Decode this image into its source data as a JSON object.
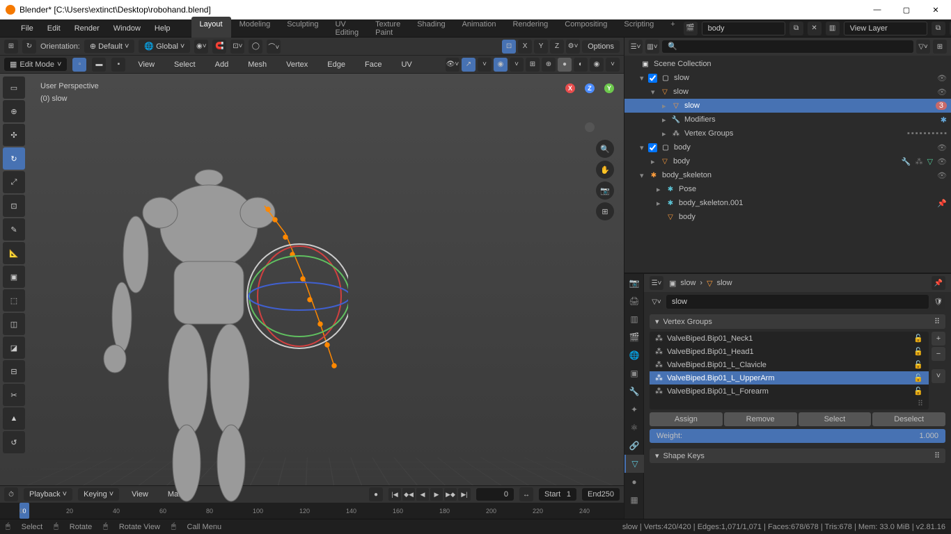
{
  "titlebar": {
    "title": "Blender* [C:\\Users\\extinct\\Desktop\\robohand.blend]"
  },
  "menus": {
    "file": "File",
    "edit": "Edit",
    "render": "Render",
    "window": "Window",
    "help": "Help"
  },
  "workspaces": {
    "layout": "Layout",
    "modeling": "Modeling",
    "sculpting": "Sculpting",
    "uv": "UV Editing",
    "texture": "Texture Paint",
    "shading": "Shading",
    "animation": "Animation",
    "rendering": "Rendering",
    "compositing": "Compositing",
    "scripting": "Scripting"
  },
  "topbar": {
    "scene_name": "body",
    "view_layer": "View Layer"
  },
  "header": {
    "orientation": "Orientation:",
    "orientation_val": "Default",
    "transform": "Global",
    "options": "Options",
    "x": "X",
    "y": "Y",
    "z": "Z"
  },
  "toolbar": {
    "mode": "Edit Mode",
    "view": "View",
    "select": "Select",
    "add": "Add",
    "mesh": "Mesh",
    "vertex": "Vertex",
    "edge": "Edge",
    "face": "Face",
    "uv": "UV"
  },
  "viewport": {
    "line1": "User Perspective",
    "line2": "(0) slow"
  },
  "outliner": {
    "root": "Scene Collection",
    "items": [
      {
        "indent": 1,
        "icon": "collection",
        "label": "slow",
        "vis": true,
        "checkbox": true
      },
      {
        "indent": 2,
        "icon": "mesh",
        "label": "slow",
        "vis": true
      },
      {
        "indent": 3,
        "icon": "mesh",
        "label": "slow",
        "vis": true,
        "selected": true,
        "badge": "3"
      },
      {
        "indent": 3,
        "icon": "modifier",
        "label": "Modifiers",
        "extra": true
      },
      {
        "indent": 3,
        "icon": "vgroup",
        "label": "Vertex Groups",
        "mods": true
      },
      {
        "indent": 1,
        "icon": "collection",
        "label": "body",
        "vis": true,
        "checkbox": true
      },
      {
        "indent": 2,
        "icon": "mesh",
        "label": "body",
        "extra2": true,
        "vis": true
      },
      {
        "indent": 1,
        "icon": "armature",
        "label": "body_skeleton",
        "vis": true
      },
      {
        "indent": 2,
        "icon": "pose",
        "label": "Pose"
      },
      {
        "indent": 2,
        "icon": "armature",
        "label": "body_skeleton.001",
        "extra": true
      },
      {
        "indent": 2,
        "icon": "mesh",
        "label": "body"
      }
    ]
  },
  "properties": {
    "breadcrumb": {
      "a": "slow",
      "b": "slow"
    },
    "search": "slow",
    "vgroups_header": "Vertex Groups",
    "vgroups": [
      {
        "name": "ValveBiped.Bip01_Neck1"
      },
      {
        "name": "ValveBiped.Bip01_Head1"
      },
      {
        "name": "ValveBiped.Bip01_L_Clavicle"
      },
      {
        "name": "ValveBiped.Bip01_L_UpperArm",
        "selected": true
      },
      {
        "name": "ValveBiped.Bip01_L_Forearm"
      }
    ],
    "actions": {
      "assign": "Assign",
      "remove": "Remove",
      "select": "Select",
      "deselect": "Deselect"
    },
    "weight_label": "Weight:",
    "weight_value": "1.000",
    "shapekeys_header": "Shape Keys"
  },
  "timeline": {
    "playback": "Playback",
    "keying": "Keying",
    "view": "View",
    "marker": "Marker",
    "current": "0",
    "start_label": "Start",
    "start": "1",
    "end_label": "End",
    "end": "250",
    "ticks": [
      "0",
      "20",
      "40",
      "60",
      "80",
      "100",
      "120",
      "140",
      "160",
      "180",
      "200",
      "220",
      "240"
    ]
  },
  "statusbar": {
    "select": "Select",
    "rotate": "Rotate",
    "rotate_view": "Rotate View",
    "call_menu": "Call Menu",
    "stats": "slow | Verts:420/420 | Edges:1,071/1,071 | Faces:678/678 | Tris:678 | Mem: 33.0 MiB | v2.81.16"
  }
}
